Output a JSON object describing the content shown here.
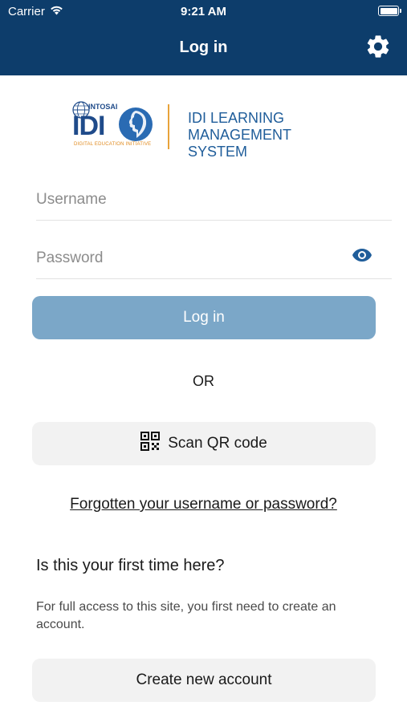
{
  "status_bar": {
    "carrier": "Carrier",
    "time": "9:21 AM",
    "wifi_icon": "wifi-icon",
    "battery_icon": "battery-icon",
    "battery_level": 1.0
  },
  "header": {
    "title": "Log in",
    "settings_icon": "gear-icon",
    "background_color": "#0d3d6b"
  },
  "logo": {
    "wordmark": "IDI",
    "org": "INTOSAI",
    "tagline": "DIGITAL EDUCATION INITIATIVE",
    "title_line1": "IDI LEARNING",
    "title_line2": "MANAGEMENT SYSTEM"
  },
  "form": {
    "username_placeholder": "Username",
    "username_value": "",
    "password_placeholder": "Password",
    "password_value": "",
    "show_password_icon": "eye-icon",
    "login_label": "Log in",
    "login_color": "#7ba7c8"
  },
  "or_label": "OR",
  "scan": {
    "label": "Scan QR code",
    "icon": "qr-code-icon"
  },
  "forgot_link": "Forgotten your username or password?",
  "signup": {
    "heading": "Is this your first time here?",
    "description": "For full access to this site, you first need to create an account.",
    "button_label": "Create new account"
  }
}
